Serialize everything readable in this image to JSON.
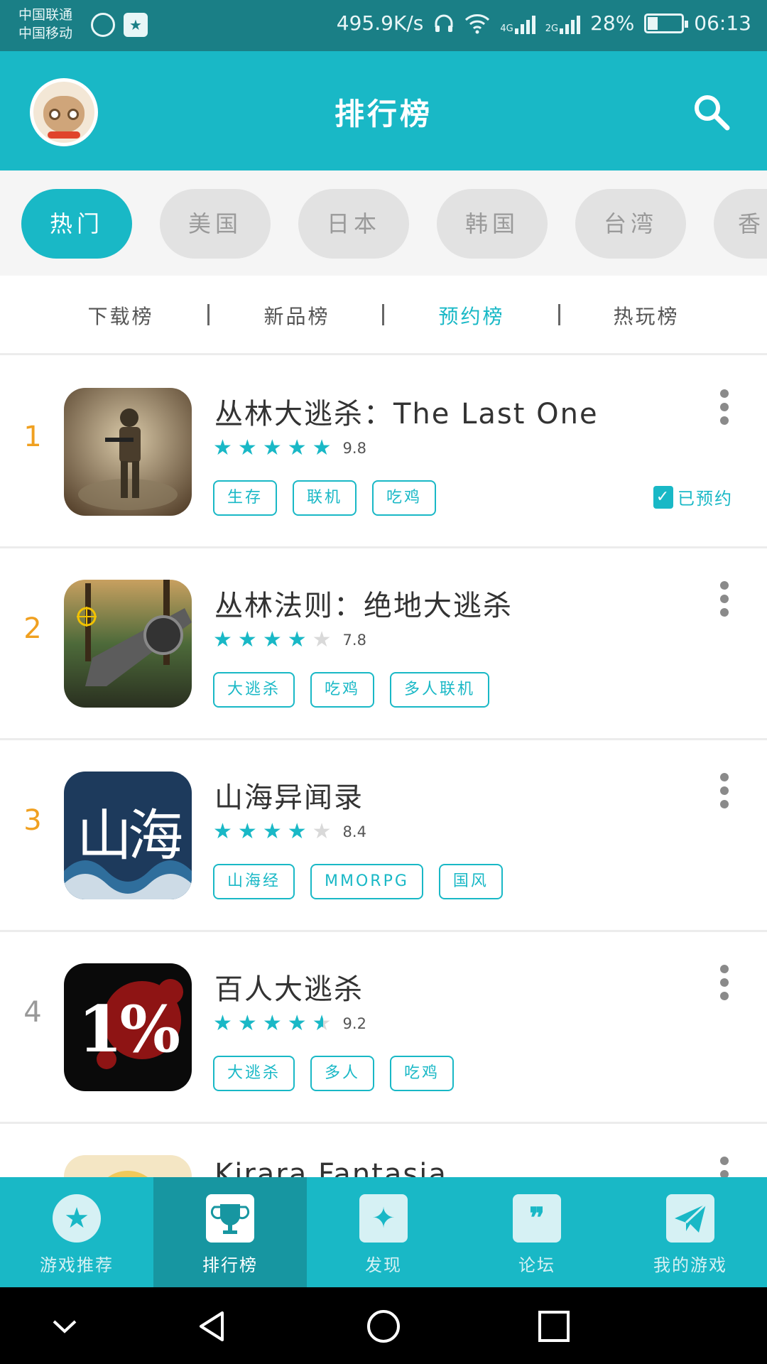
{
  "status_bar": {
    "carrier_1": "中国联通",
    "carrier_2": "中国移动",
    "speed": "495.9K/s",
    "net_1": "4G",
    "net_2": "2G",
    "battery": "28%",
    "time": "06:13"
  },
  "header": {
    "title": "排行榜"
  },
  "regions": [
    {
      "label": "热门",
      "active": true
    },
    {
      "label": "美国",
      "active": false
    },
    {
      "label": "日本",
      "active": false
    },
    {
      "label": "韩国",
      "active": false
    },
    {
      "label": "台湾",
      "active": false
    },
    {
      "label": "香",
      "active": false
    }
  ],
  "subtabs": [
    {
      "label": "下载榜",
      "active": false
    },
    {
      "label": "新品榜",
      "active": false
    },
    {
      "label": "预约榜",
      "active": true
    },
    {
      "label": "热玩榜",
      "active": false
    }
  ],
  "games": [
    {
      "rank": "1",
      "rank_color": "#f0a020",
      "name": "丛林大逃杀：The Last One",
      "rating": 5,
      "score": "9.8",
      "tags": [
        "生存",
        "联机",
        "吃鸡"
      ],
      "status": "已预约"
    },
    {
      "rank": "2",
      "rank_color": "#f0a020",
      "name": "丛林法则：绝地大逃杀",
      "rating": 4,
      "score": "7.8",
      "tags": [
        "大逃杀",
        "吃鸡",
        "多人联机"
      ]
    },
    {
      "rank": "3",
      "rank_color": "#f0a020",
      "name": "山海异闻录",
      "rating": 4,
      "score": "8.4",
      "tags": [
        "山海经",
        "MMORPG",
        "国风"
      ],
      "thumb_text": "山海"
    },
    {
      "rank": "4",
      "rank_color": "#999999",
      "name": "百人大逃杀",
      "rating": 4.5,
      "score": "9.2",
      "tags": [
        "大逃杀",
        "多人",
        "吃鸡"
      ],
      "thumb_text": "1%"
    },
    {
      "rank": "",
      "rank_color": "#999999",
      "name": "Kirara Fantasia",
      "rating": 0,
      "score": "",
      "tags": []
    }
  ],
  "bottom_nav": [
    {
      "label": "游戏推荐",
      "icon": "star-icon",
      "active": false
    },
    {
      "label": "排行榜",
      "icon": "trophy-icon",
      "active": true
    },
    {
      "label": "发现",
      "icon": "sparkle-icon",
      "active": false
    },
    {
      "label": "论坛",
      "icon": "quote-icon",
      "active": false
    },
    {
      "label": "我的游戏",
      "icon": "paper-plane-icon",
      "active": false
    }
  ],
  "colors": {
    "accent": "#19b8c6",
    "header": "#19b8c6",
    "statusbar": "#1a7f86",
    "rank_top": "#f0a020"
  }
}
